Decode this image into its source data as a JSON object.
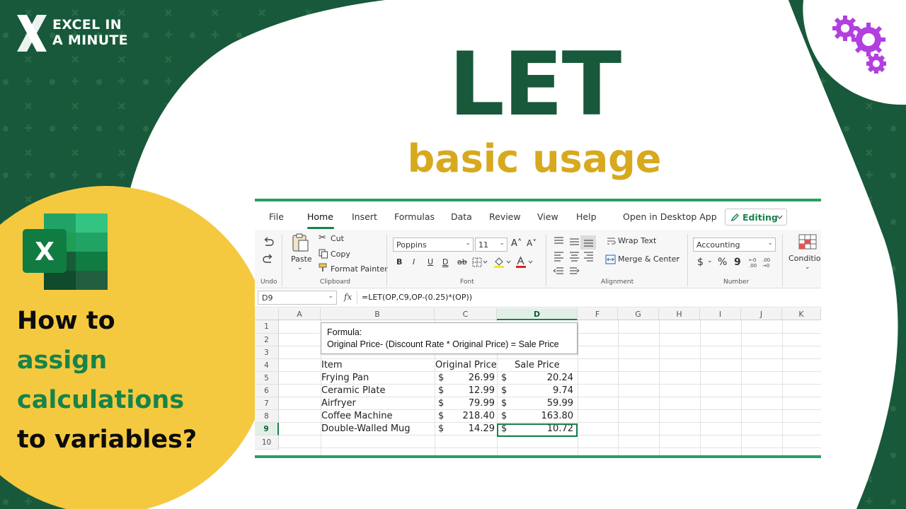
{
  "brand": {
    "line1": "EXCEL IN",
    "line2": "A MINUTE",
    "logo_icon": "x-logo-icon"
  },
  "title": {
    "main": "LET",
    "sub": "basic usage"
  },
  "question": {
    "line1": "How to",
    "line2": "assign",
    "line3": "calculations",
    "line4": "to variables?"
  },
  "colors": {
    "dark_green": "#17593a",
    "accent_green": "#17834a",
    "yellow": "#f5c93f",
    "gold_text": "#d7a91e",
    "gear_purple": "#b23fe0"
  },
  "decor": {
    "gears_icon": "gears-icon",
    "excel_logo_icon": "excel-logo-icon",
    "excel_logo_letter": "X"
  },
  "excel": {
    "tabs": [
      "File",
      "Home",
      "Insert",
      "Formulas",
      "Data",
      "Review",
      "View",
      "Help"
    ],
    "active_tab": "Home",
    "open_desktop": "Open in Desktop App",
    "editing": "Editing",
    "ribbon": {
      "undo_label": "Undo",
      "paste": "Paste",
      "cut": "Cut",
      "copy": "Copy",
      "format_painter": "Format Painter",
      "clipboard_label": "Clipboard",
      "font_name": "Poppins",
      "font_size": "11",
      "bold": "B",
      "italic": "I",
      "underline": "U",
      "double_underline": "D",
      "strike": "ab",
      "font_label": "Font",
      "wrap_text": "Wrap Text",
      "merge_center": "Merge & Center",
      "alignment_label": "Alignment",
      "number_format": "Accounting",
      "currency": "$",
      "percent": "%",
      "comma": "9",
      "number_label": "Number",
      "conditional": "Condition"
    },
    "name_box": "D9",
    "fx": "fx",
    "formula": "=LET(OP,C9,OP-(0.25)*(OP))",
    "columns": [
      "A",
      "B",
      "C",
      "D",
      "F",
      "G",
      "H",
      "I",
      "J",
      "K"
    ],
    "selected_column": "D",
    "rows": [
      "1",
      "2",
      "3",
      "4",
      "5",
      "6",
      "7",
      "8",
      "9",
      "10"
    ],
    "selected_row": "9",
    "note": {
      "line1": "Formula:",
      "line2": "Original Price- (Discount Rate * Original Price) = Sale Price"
    },
    "headers": {
      "item": "Item",
      "original": "Original Price",
      "sale": "Sale Price"
    },
    "data": [
      {
        "item": "Frying Pan",
        "original": "26.99",
        "sale": "20.24"
      },
      {
        "item": "Ceramic Plate",
        "original": "12.99",
        "sale": "9.74"
      },
      {
        "item": "Airfryer",
        "original": "79.99",
        "sale": "59.99"
      },
      {
        "item": "Coffee Machine",
        "original": "218.40",
        "sale": "163.80"
      },
      {
        "item": "Double-Walled Mug",
        "original": "14.29",
        "sale": "10.72"
      }
    ],
    "currency_symbol": "$"
  }
}
